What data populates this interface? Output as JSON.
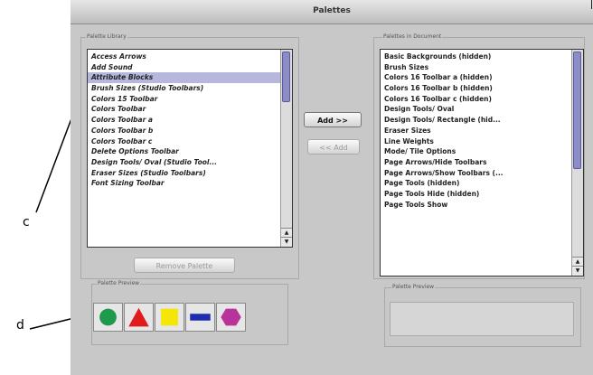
{
  "window": {
    "title": "Palettes"
  },
  "library": {
    "label": "Palette Library",
    "items": [
      "Access Arrows",
      "Add Sound",
      "Attribute Blocks",
      "Brush Sizes (Studio Toolbars)",
      "Colors 15 Toolbar",
      "Colors Toolbar",
      "Colors Toolbar a",
      "Colors Toolbar b",
      "Colors Toolbar c",
      "Delete Options Toolbar",
      "Design Tools/ Oval (Studio Tool...",
      "Eraser Sizes (Studio Toolbars)",
      "Font Sizing Toolbar"
    ],
    "selected_index": 2
  },
  "buttons": {
    "add": "Add >>",
    "remove_short": "<< Add",
    "remove_palette": "Remove Palette"
  },
  "document": {
    "label": "Palettes in Document",
    "items": [
      "Basic Backgrounds (hidden)",
      "Brush Sizes",
      "Colors 16 Toolbar a (hidden)",
      "Colors 16 Toolbar b (hidden)",
      "Colors 16 Toolbar c (hidden)",
      "Design Tools/ Oval",
      "Design Tools/ Rectangle (hid...",
      "Eraser Sizes",
      "Line Weights",
      "Mode/ Tile Options",
      "Page Arrows/Hide Toolbars",
      "Page Arrows/Show Toolbars (...",
      "Page Tools (hidden)",
      "Page Tools Hide (hidden)",
      "Page Tools Show"
    ]
  },
  "preview_left": {
    "label": "Palette Preview",
    "swatches": [
      {
        "shape": "circle",
        "color": "#1f9a4a"
      },
      {
        "shape": "triangle",
        "color": "#e01c1c"
      },
      {
        "shape": "square",
        "color": "#f5e60a"
      },
      {
        "shape": "bar",
        "color": "#1e2db0"
      },
      {
        "shape": "hexagon",
        "color": "#b8349a"
      }
    ]
  },
  "preview_right": {
    "label": "Palette Preview"
  },
  "annotations": {
    "c": "c",
    "d": "d"
  }
}
